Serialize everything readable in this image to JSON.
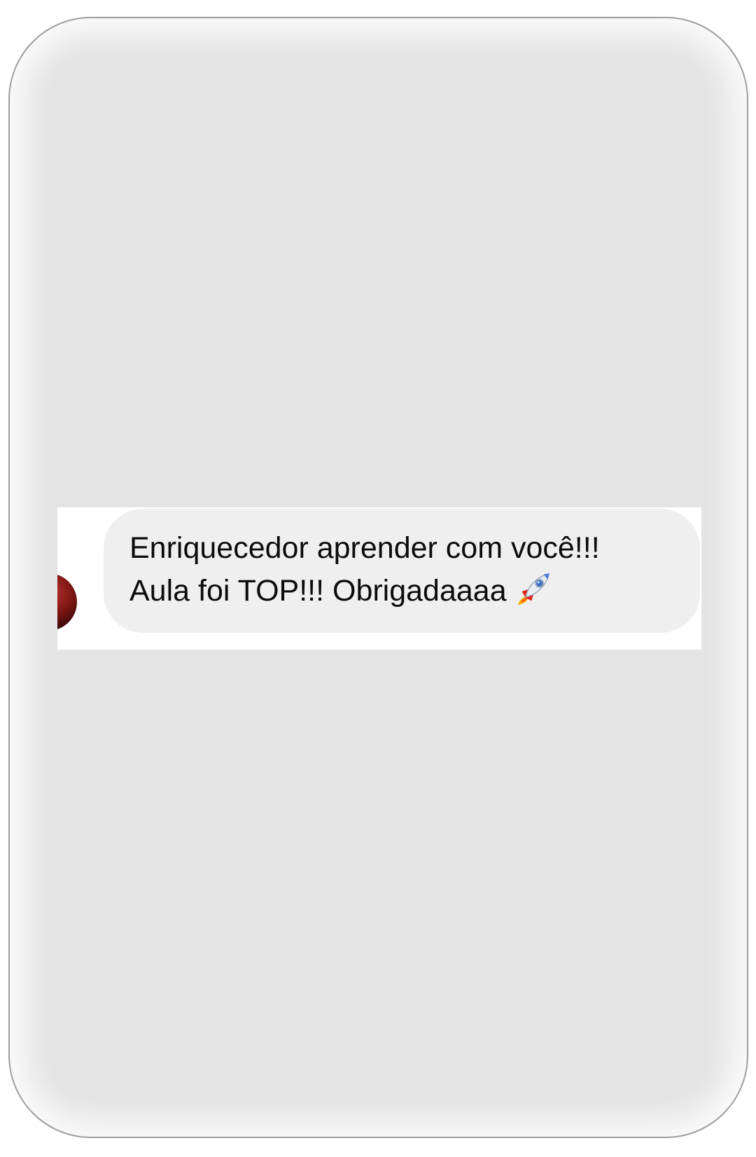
{
  "message": {
    "line1": "Enriquecedor aprender com você!!!",
    "line2": "Aula foi TOP!!! Obrigadaaaa"
  },
  "icons": {
    "avatar": "avatar",
    "emoji": "rocket-icon"
  },
  "colors": {
    "frame_background": "#e4e4e4",
    "bubble_background": "#efefef",
    "strip_background": "#ffffff",
    "text": "#0c0c0c",
    "avatar_red": "#7a1512"
  }
}
